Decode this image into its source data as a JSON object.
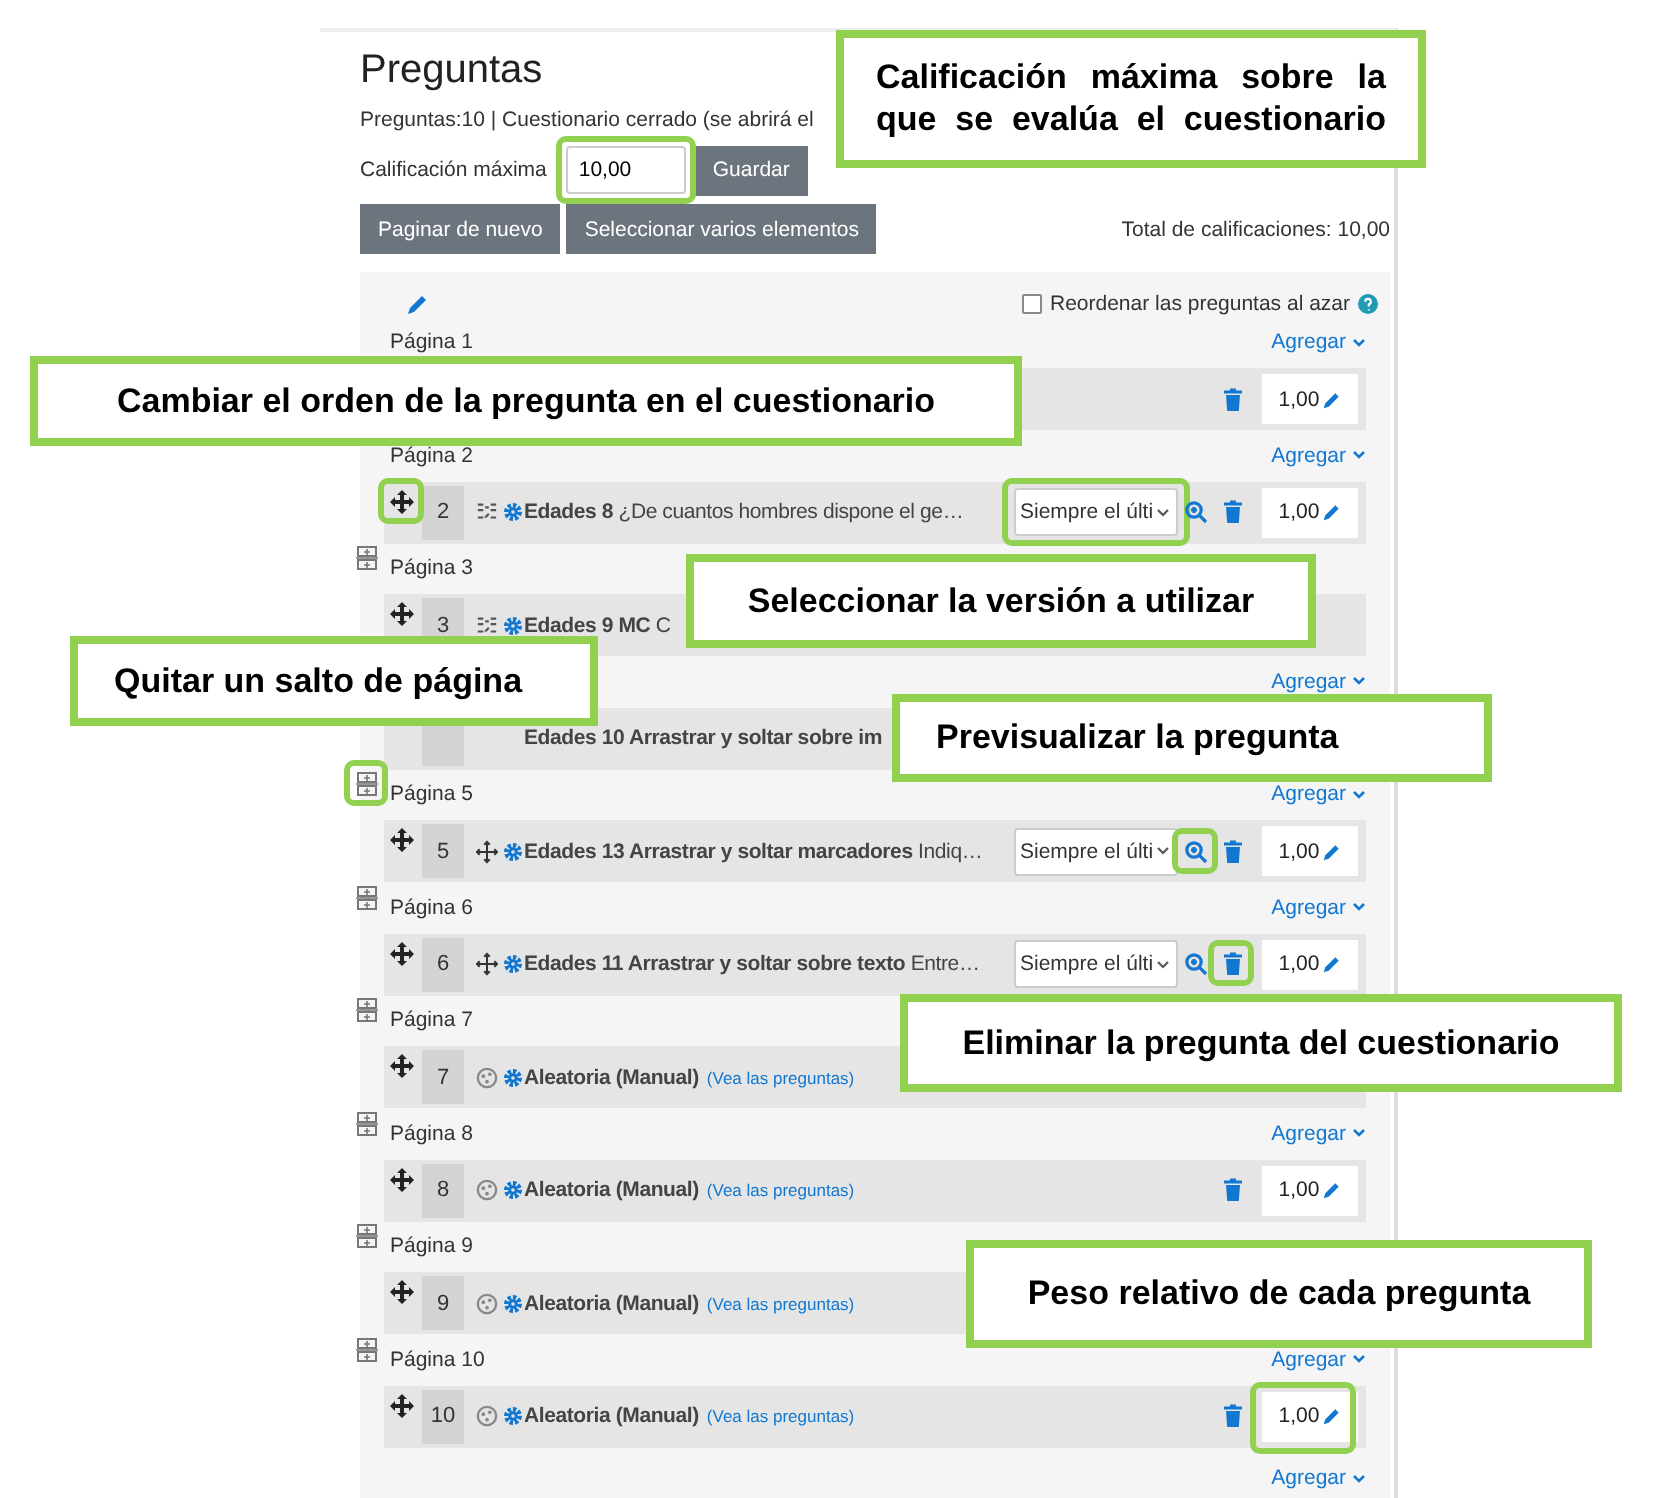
{
  "header": {
    "title": "Preguntas",
    "info": "Preguntas:10 | Cuestionario cerrado (se abrirá el",
    "grade_label": "Calificación máxima",
    "grade_value": "10,00",
    "grade_highlighted": true,
    "save": "Guardar"
  },
  "buttons": [
    "Paginar de nuevo",
    "Seleccionar varios elementos"
  ],
  "total": "Total de calificaciones: 10,00",
  "shuffle": {
    "label": "Reordenar las preguntas al azar",
    "checked": false
  },
  "pages": [
    {
      "label": "Página 1",
      "add": "Agregar",
      "question": {
        "delete": true,
        "grade": "1,00"
      }
    },
    {
      "label": "Página 2",
      "add": "Agregar",
      "break_after": true,
      "question": {
        "kind": "matching",
        "move": true,
        "move_highlighted": true,
        "number": "2",
        "title": "Edades 8",
        "text": "¿De cuantos hombres dispone el ge…",
        "select": "Siempre el últi",
        "select_highlighted": true,
        "preview": true,
        "delete": true,
        "grade": "1,00"
      }
    },
    {
      "label": "Página 3",
      "question": {
        "kind": "matching",
        "move": true,
        "number": "3",
        "title": "Edades 9 MC",
        "text": "C"
      }
    },
    {
      "add": "Agregar",
      "break_after": true,
      "break_highlighted": true,
      "question": {
        "title": "Edades 10 Arrastrar y soltar sobre im"
      }
    },
    {
      "label": "Página 5",
      "add": "Agregar",
      "break_after": true,
      "question": {
        "kind": "dragdrop",
        "move": true,
        "number": "5",
        "title": "Edades 13 Arrastrar y soltar marcadores",
        "text": "Indiq…",
        "select": "Siempre el últi",
        "preview": true,
        "preview_highlighted": true,
        "delete": true,
        "grade": "1,00"
      }
    },
    {
      "label": "Página 6",
      "add": "Agregar",
      "break_after": true,
      "question": {
        "kind": "dragdrop",
        "move": true,
        "number": "6",
        "title": "Edades 11 Arrastrar y soltar sobre texto",
        "text": "Entre…",
        "select": "Siempre el últi",
        "preview": true,
        "delete": true,
        "delete_highlighted": true,
        "grade": "1,00"
      }
    },
    {
      "label": "Página 7",
      "break_after": true,
      "question": {
        "kind": "random",
        "move": true,
        "number": "7",
        "title": "Aleatoria (Manual)",
        "link": "(Vea las preguntas)"
      }
    },
    {
      "label": "Página 8",
      "add": "Agregar",
      "break_after": true,
      "question": {
        "kind": "random",
        "move": true,
        "number": "8",
        "title": "Aleatoria (Manual)",
        "link": "(Vea las preguntas)",
        "delete": true,
        "grade": "1,00"
      }
    },
    {
      "label": "Página 9",
      "break_after": true,
      "question": {
        "kind": "random",
        "move": true,
        "number": "9",
        "title": "Aleatoria (Manual)",
        "link": "(Vea las preguntas)"
      }
    },
    {
      "label": "Página 10",
      "add": "Agregar",
      "question": {
        "kind": "random",
        "move": true,
        "number": "10",
        "title": "Aleatoria (Manual)",
        "link": "(Vea las preguntas)",
        "delete": true,
        "grade": "1,00",
        "grade_highlighted": true
      }
    }
  ],
  "final_add": "Agregar",
  "callouts": [
    "Calificación máxima sobre la que se evalúa el cuestionario",
    "Cambiar el orden de la pregunta en el cuestionario",
    "Seleccionar la versión a utilizar",
    "Quitar un salto de página",
    "Previsualizar la pregunta",
    "Eliminar la pregunta del cuestionario",
    "Peso relativo de cada pregunta"
  ]
}
